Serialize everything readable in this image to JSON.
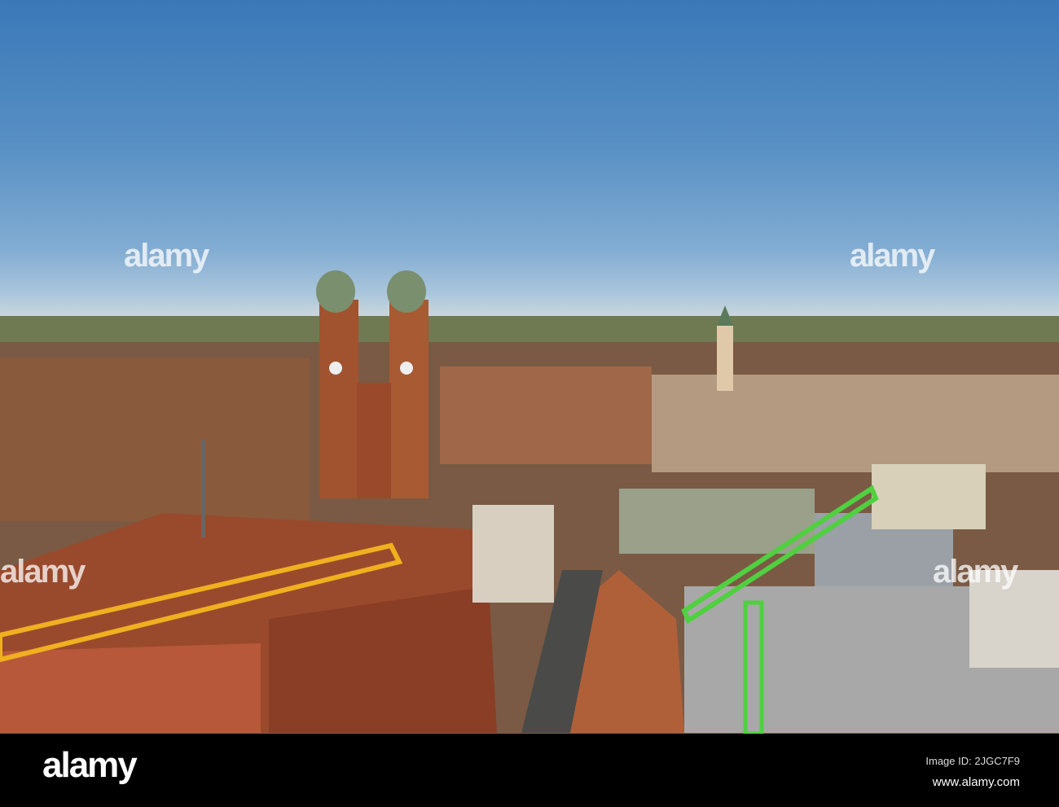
{
  "photo": {
    "subject": "Munich skyline aerial view",
    "watermark_text": "alamy"
  },
  "footer": {
    "logo": "alamy",
    "image_id": "Image ID: 2JGC7F9",
    "url": "www.alamy.com"
  }
}
